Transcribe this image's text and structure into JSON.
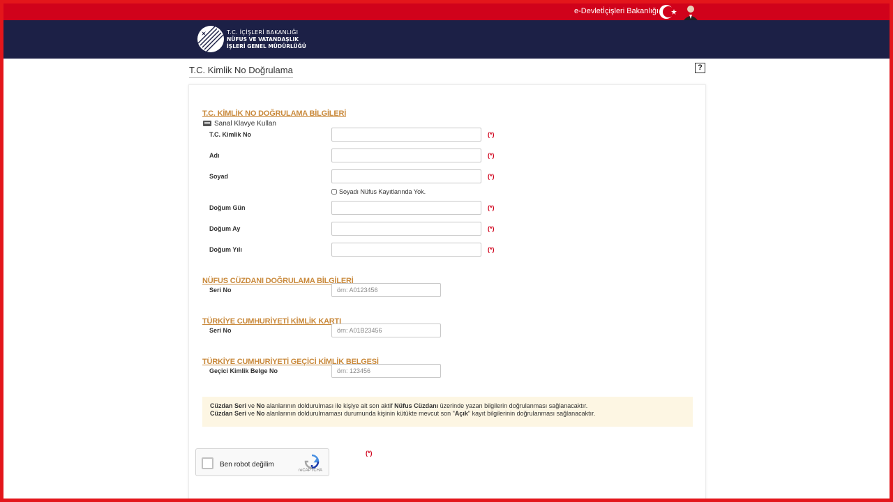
{
  "topbar": {
    "links": [
      "e-Devlet",
      "İçişleri Bakanlığı"
    ]
  },
  "header": {
    "logo_line1": "T.C. İÇİŞLERİ BAKANLIĞI",
    "logo_line2": "NÜFUS VE VATANDAŞLIK",
    "logo_line3": "İŞLERİ GENEL MÜDÜRLÜĞÜ"
  },
  "page": {
    "title": "T.C. Kimlik No Doğrulama",
    "help_label": "?"
  },
  "sections": {
    "kimlik": "T.C. KİMLİK NO DOĞRULAMA BİLGİLERİ",
    "cuzdan": "NÜFUS CÜZDANI DOĞRULAMA BİLGİLERİ",
    "kart": "TÜRKİYE CUMHURİYETİ KİMLİK KARTI",
    "gecici": "TÜRKİYE CUMHURİYETİ GEÇİCİ KİMLİK BELGESİ"
  },
  "virtual_keyboard": "Sanal Klavye Kullan",
  "required_marker": "(*)",
  "fields": {
    "tckn": {
      "label": "T.C. Kimlik No",
      "value": ""
    },
    "ad": {
      "label": "Adı",
      "value": ""
    },
    "soyad": {
      "label": "Soyad",
      "value": ""
    },
    "dogum_gun": {
      "label": "Doğum Gün",
      "value": ""
    },
    "dogum_ay": {
      "label": "Doğum Ay",
      "value": ""
    },
    "dogum_yili": {
      "label": "Doğum Yılı",
      "value": ""
    },
    "cuzdan_seri": {
      "label": "Seri No",
      "placeholder": "örn: A0123456"
    },
    "kart_seri": {
      "label": "Seri No",
      "placeholder": "örn: A01B23456"
    },
    "gecici_no": {
      "label": "Geçici Kimlik Belge No",
      "placeholder": "örn: 123456"
    }
  },
  "soyad_checkbox": {
    "label": "Soyadı Nüfus Kayıtlarında Yok.",
    "checked": false
  },
  "info": {
    "line1_a": "Cüzdan Seri",
    "line1_b": " ve ",
    "line1_c": "No",
    "line1_d": " alanlarının doldurulması ile kişiye ait son aktif ",
    "line1_e": "Nüfus Cüzdanı",
    "line1_f": " üzerinde yazan bilgilerin doğrulanması sağlanacaktır.",
    "line2_a": "Cüzdan Seri",
    "line2_b": " ve ",
    "line2_c": "No",
    "line2_d": " alanlarının doldurulmaması durumunda kişinin kütükte mevcut son \"",
    "line2_e": "Açık",
    "line2_f": "\" kayıt bilgilerinin doğrulanması sağlanacaktır."
  },
  "captcha": {
    "label": "Ben robot değilim",
    "brand": "reCAPTCHA",
    "checked": false
  },
  "colors": {
    "topbar": "#d0021b",
    "header": "#1c2046",
    "section_title": "#c9893b",
    "required": "#d0021b",
    "info_bg": "#fdf6e3"
  }
}
